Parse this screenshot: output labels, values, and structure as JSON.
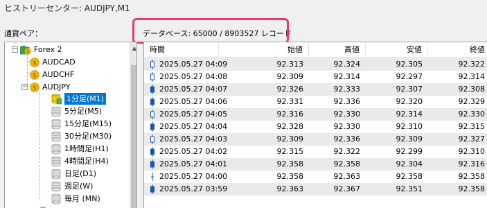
{
  "window": {
    "title": "ヒストリーセンター: AUDJPY,M1"
  },
  "pairs_label": "通貨ペア：",
  "db_info": "データベース: 65000 / 8903527 レコード",
  "tree": {
    "root": "Forex 2",
    "items": [
      {
        "label": "AUDCAD"
      },
      {
        "label": "AUDCHF"
      },
      {
        "label": "AUDJPY"
      }
    ],
    "timeframes": [
      {
        "label": "1分足(M1)",
        "selected": true
      },
      {
        "label": "5分足(M5)"
      },
      {
        "label": "15分足(M15)"
      },
      {
        "label": "30分足(M30)"
      },
      {
        "label": "1時間足(H1)"
      },
      {
        "label": "4時間足(H4)"
      },
      {
        "label": "日足(D1)"
      },
      {
        "label": "週足(W)"
      },
      {
        "label": "毎月 (MN)"
      }
    ]
  },
  "table": {
    "headers": [
      "時間",
      "始値",
      "高値",
      "安値",
      "終値"
    ],
    "rows": [
      {
        "time": "2025.05.27 04:09",
        "open": "92.313",
        "high": "92.324",
        "low": "92.305",
        "close": "92.322",
        "type": "hollow"
      },
      {
        "time": "2025.05.27 04:08",
        "open": "92.309",
        "high": "92.314",
        "low": "92.297",
        "close": "92.314",
        "type": "hollow"
      },
      {
        "time": "2025.05.27 04:07",
        "open": "92.326",
        "high": "92.333",
        "low": "92.307",
        "close": "92.308",
        "type": "solid"
      },
      {
        "time": "2025.05.27 04:06",
        "open": "92.331",
        "high": "92.336",
        "low": "92.320",
        "close": "92.329",
        "type": "solid"
      },
      {
        "time": "2025.05.27 04:05",
        "open": "92.316",
        "high": "92.330",
        "low": "92.314",
        "close": "92.330",
        "type": "hollow"
      },
      {
        "time": "2025.05.27 04:04",
        "open": "92.328",
        "high": "92.330",
        "low": "92.310",
        "close": "92.315",
        "type": "solid"
      },
      {
        "time": "2025.05.27 04:03",
        "open": "92.309",
        "high": "92.336",
        "low": "92.309",
        "close": "92.327",
        "type": "hollow"
      },
      {
        "time": "2025.05.27 04:02",
        "open": "92.315",
        "high": "92.322",
        "low": "92.299",
        "close": "92.310",
        "type": "solid"
      },
      {
        "time": "2025.05.27 04:01",
        "open": "92.358",
        "high": "92.358",
        "low": "92.304",
        "close": "92.316",
        "type": "solid"
      },
      {
        "time": "2025.05.27 04:00",
        "open": "92.358",
        "high": "92.363",
        "low": "92.358",
        "close": "92.358",
        "type": "cross"
      },
      {
        "time": "2025.05.27 03:59",
        "open": "92.363",
        "high": "92.367",
        "low": "92.351",
        "close": "92.358",
        "type": "solid"
      }
    ]
  },
  "colors": {
    "selection": "#0078d7",
    "highlight": "#e83a6e",
    "coin": "#f5b400"
  }
}
